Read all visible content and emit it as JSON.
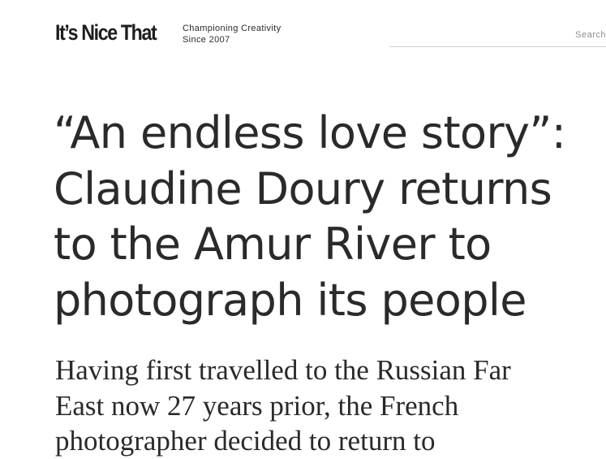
{
  "header": {
    "logo": "It’s Nice That",
    "tagline_line1": "Championing Creativity",
    "tagline_line2": "Since 2007",
    "search": {
      "placeholder": "Search",
      "value": ""
    }
  },
  "article": {
    "headline_lines": [
      "“An endless love story”:",
      "Claudine Doury returns",
      "to the Amur River to",
      "photograph its people"
    ],
    "standfirst_lines": [
      "Having first travelled to the Russian Far",
      "East now 27 years prior, the French",
      "photographer decided to return to"
    ]
  }
}
